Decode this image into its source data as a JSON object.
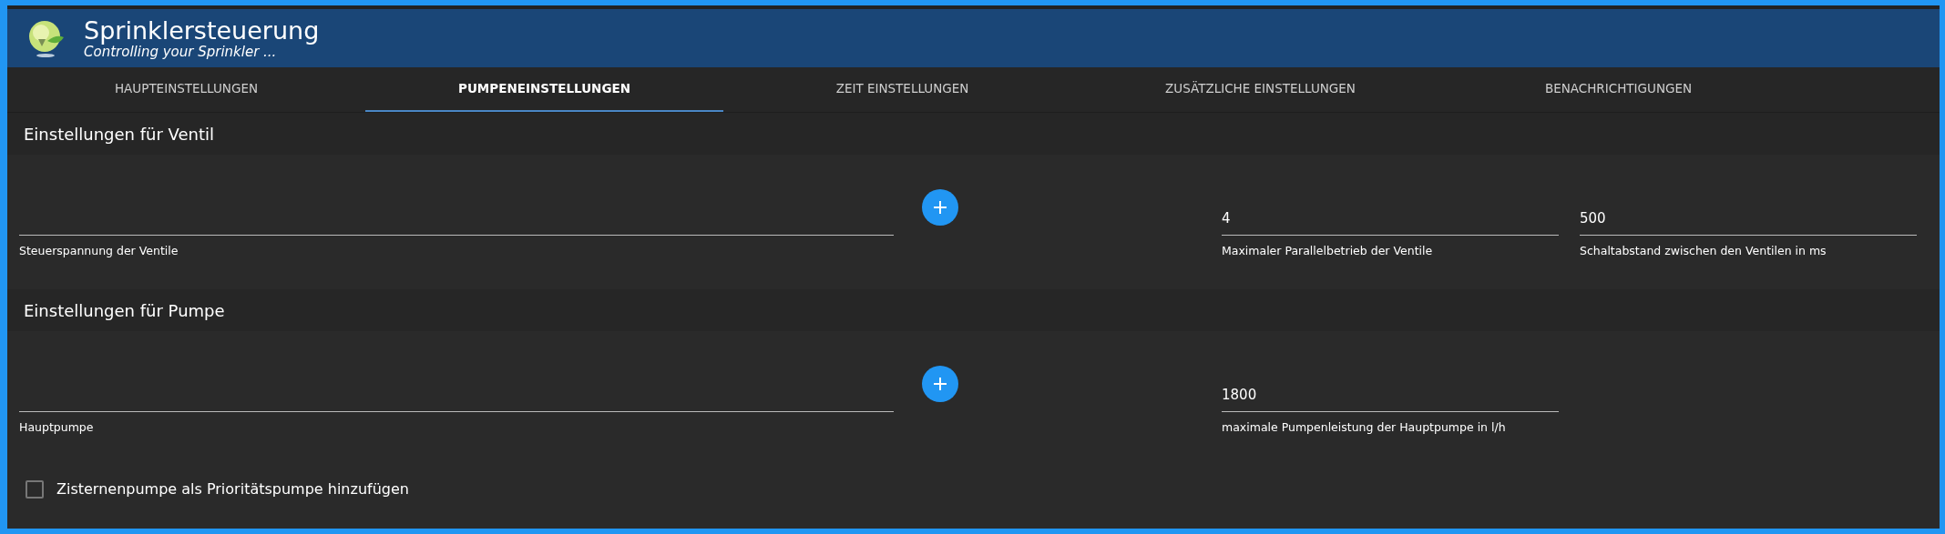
{
  "header": {
    "title": "Sprinklersteuerung",
    "subtitle": "Controlling your Sprinkler ..."
  },
  "tabs": [
    {
      "label": "HAUPTEINSTELLUNGEN",
      "selected": false
    },
    {
      "label": "PUMPENEINSTELLUNGEN",
      "selected": true
    },
    {
      "label": "ZEIT EINSTELLUNGEN",
      "selected": false
    },
    {
      "label": "ZUSÄTZLICHE EINSTELLUNGEN",
      "selected": false
    },
    {
      "label": "BENACHRICHTIGUNGEN",
      "selected": false
    }
  ],
  "sections": [
    {
      "title": "Einstellungen für Ventil",
      "items": [
        {
          "kind": "field",
          "label": "Steuerspannung der Ventile"
        },
        {
          "kind": "add"
        },
        {
          "kind": "field",
          "label": "Maximaler Parallelbetrieb der Ventile",
          "value": "4"
        },
        {
          "kind": "field",
          "label": "Schaltabstand zwischen den Ventilen in ms",
          "value": "500"
        }
      ]
    },
    {
      "title": "Einstellungen für Pumpe",
      "items": [
        {
          "kind": "field",
          "label": "Hauptpumpe"
        },
        {
          "kind": "add"
        },
        {
          "kind": "field",
          "label": "maximale Pumpenleistung der Hauptpumpe in l/h",
          "value": "1800"
        }
      ]
    }
  ],
  "checkbox": {
    "label": "Zisternenpumpe als Prioritätspumpe hinzufügen",
    "checked": false
  }
}
